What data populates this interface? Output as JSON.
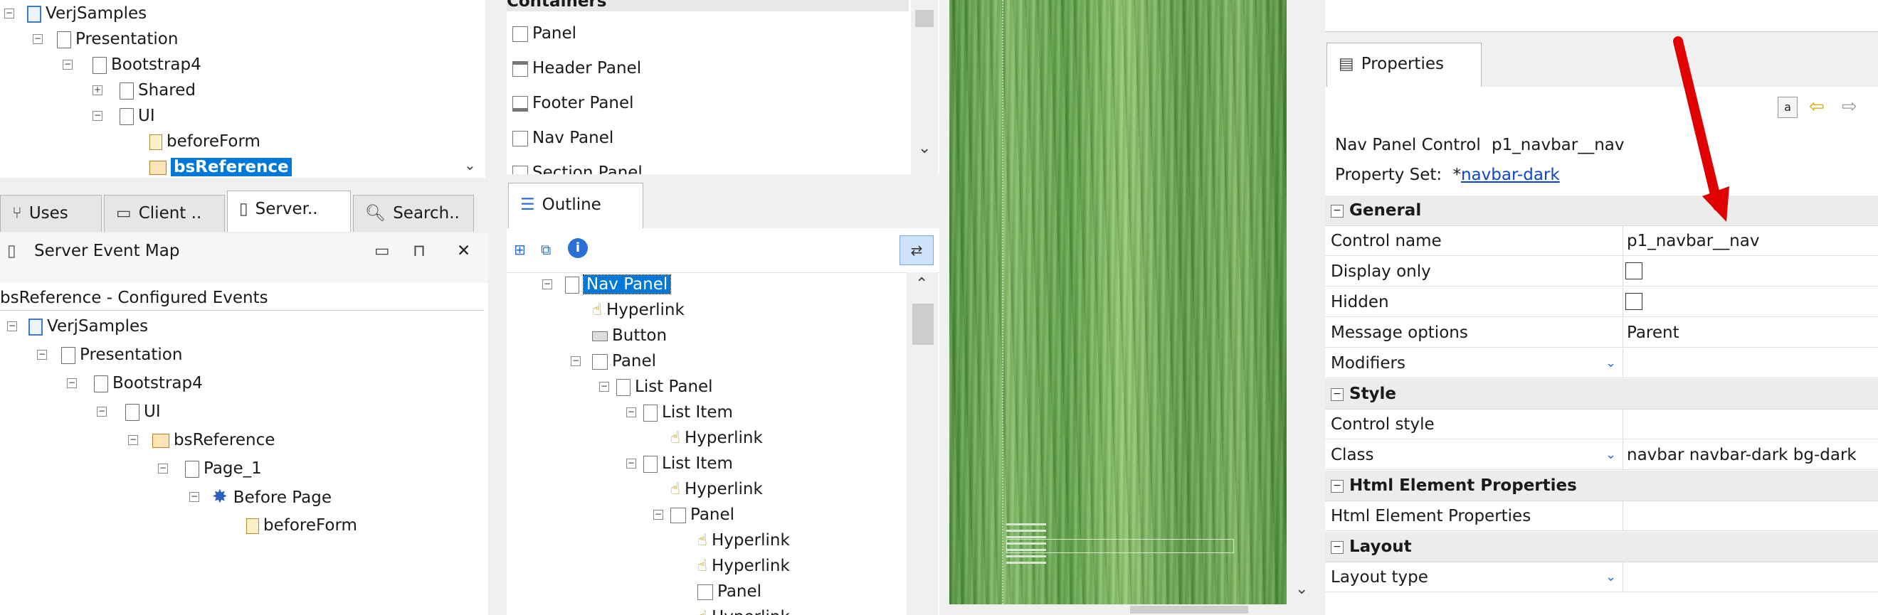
{
  "left_top_tree": {
    "items": [
      {
        "label": "VerjSamples"
      },
      {
        "label": "Presentation"
      },
      {
        "label": "Bootstrap4"
      },
      {
        "label": "Shared"
      },
      {
        "label": "UI"
      },
      {
        "label": "beforeForm"
      },
      {
        "label": "bsReference"
      }
    ]
  },
  "left_tabs": [
    {
      "label": "Uses"
    },
    {
      "label": "Client .."
    },
    {
      "label": "Server.."
    },
    {
      "label": "Search.."
    }
  ],
  "server_event_map": {
    "title": "Server Event Map",
    "configured_title": "bsReference - Configured Events",
    "items": [
      {
        "label": "VerjSamples"
      },
      {
        "label": "Presentation"
      },
      {
        "label": "Bootstrap4"
      },
      {
        "label": "UI"
      },
      {
        "label": "bsReference"
      },
      {
        "label": "Page_1"
      },
      {
        "label": "Before Page"
      },
      {
        "label": "beforeForm"
      }
    ]
  },
  "palette": {
    "header": "Containers",
    "items": [
      {
        "label": "Panel"
      },
      {
        "label": "Header Panel"
      },
      {
        "label": "Footer Panel"
      },
      {
        "label": "Nav Panel"
      },
      {
        "label": "Section Panel"
      }
    ]
  },
  "outline": {
    "tab_label": "Outline",
    "items": [
      {
        "label": "Nav Panel"
      },
      {
        "label": "Hyperlink"
      },
      {
        "label": "Button"
      },
      {
        "label": "Panel"
      },
      {
        "label": "List Panel"
      },
      {
        "label": "List Item"
      },
      {
        "label": "Hyperlink"
      },
      {
        "label": "List Item"
      },
      {
        "label": "Hyperlink"
      },
      {
        "label": "Panel"
      },
      {
        "label": "Hyperlink"
      },
      {
        "label": "Hyperlink"
      },
      {
        "label": "Panel"
      },
      {
        "label": "Hyperlink"
      }
    ]
  },
  "properties": {
    "tab_label": "Properties",
    "control_label": "Nav Panel Control",
    "control_id": "p1_navbar__nav",
    "property_set_label": "Property Set:",
    "property_set_prefix": "*",
    "property_set_value": "navbar-dark",
    "categories": {
      "general": "General",
      "style": "Style",
      "html": "Html Element Properties",
      "layout": "Layout"
    },
    "rows": {
      "control_name": {
        "name": "Control name",
        "value": "p1_navbar__nav"
      },
      "display_only": {
        "name": "Display only"
      },
      "hidden": {
        "name": "Hidden"
      },
      "message_options": {
        "name": "Message options",
        "value": "Parent"
      },
      "modifiers": {
        "name": "Modifiers"
      },
      "control_style": {
        "name": "Control style"
      },
      "class": {
        "name": "Class",
        "value": "navbar navbar-dark bg-dark"
      },
      "html_props": {
        "name": "Html Element Properties"
      },
      "layout_type": {
        "name": "Layout type"
      }
    },
    "checkboxes": {
      "display_only": false,
      "hidden": false
    }
  },
  "colors": {
    "selection": "#0078d7",
    "annotation_arrow": "#e00000",
    "link": "#0b45d6"
  }
}
